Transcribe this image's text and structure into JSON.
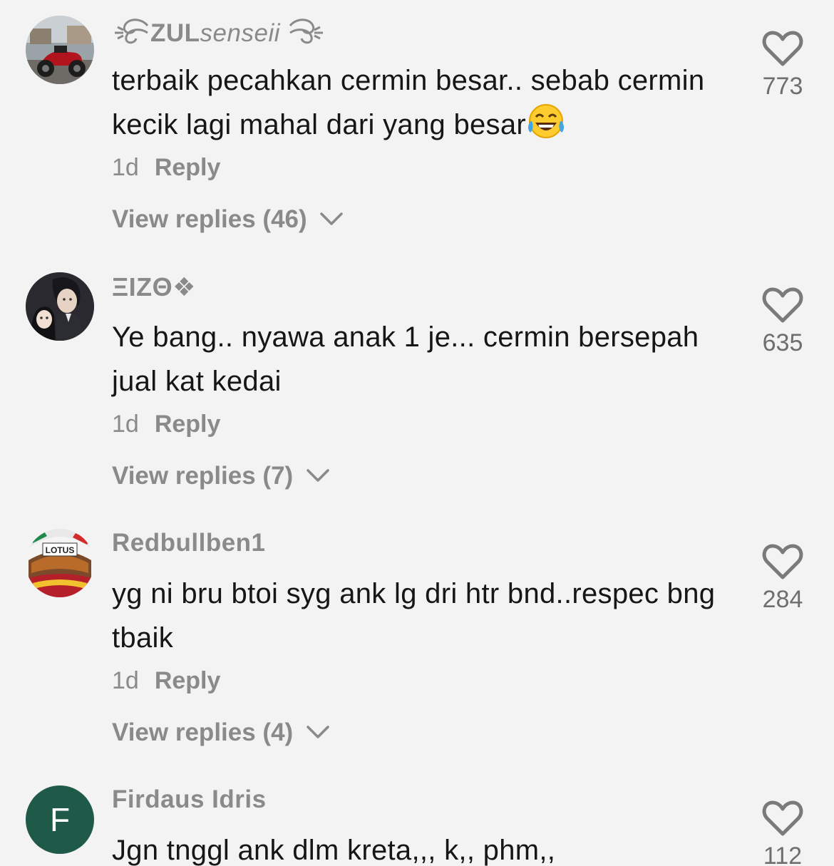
{
  "comments": [
    {
      "username": "ZUL",
      "username_suffix": "senseii",
      "text": "terbaik pecahkan cermin besar.. sebab cermin kecik lagi mahal dari yang besar",
      "emoji": "tears-of-joy-emoji",
      "time": "1d",
      "reply_label": "Reply",
      "view_replies": "View replies (46)",
      "likes": "773"
    },
    {
      "username": "ΞIZΘ❖",
      "text": "Ye bang.. nyawa anak 1 je... cermin bersepah jual kat kedai",
      "time": "1d",
      "reply_label": "Reply",
      "view_replies": "View replies (7)",
      "likes": "635"
    },
    {
      "username": "Redbullben1",
      "avatar_label": "LOTUS",
      "text": "yg ni bru btoi syg ank lg dri htr bnd..respec bng tbaik",
      "time": "1d",
      "reply_label": "Reply",
      "view_replies": "View replies (4)",
      "likes": "284"
    },
    {
      "username": "Firdaus Idris",
      "avatar_letter": "F",
      "text": "Jgn tnggl ank dlm kreta,,, k,, phm,,",
      "likes": "112"
    }
  ],
  "icons": {
    "like": "heart-outline-icon",
    "expand": "chevron-down-icon"
  },
  "colors": {
    "background": "#f3f3f3",
    "text": "#161616",
    "muted": "#8a8a8a",
    "avatar_letter_bg": "#1f5a49"
  }
}
